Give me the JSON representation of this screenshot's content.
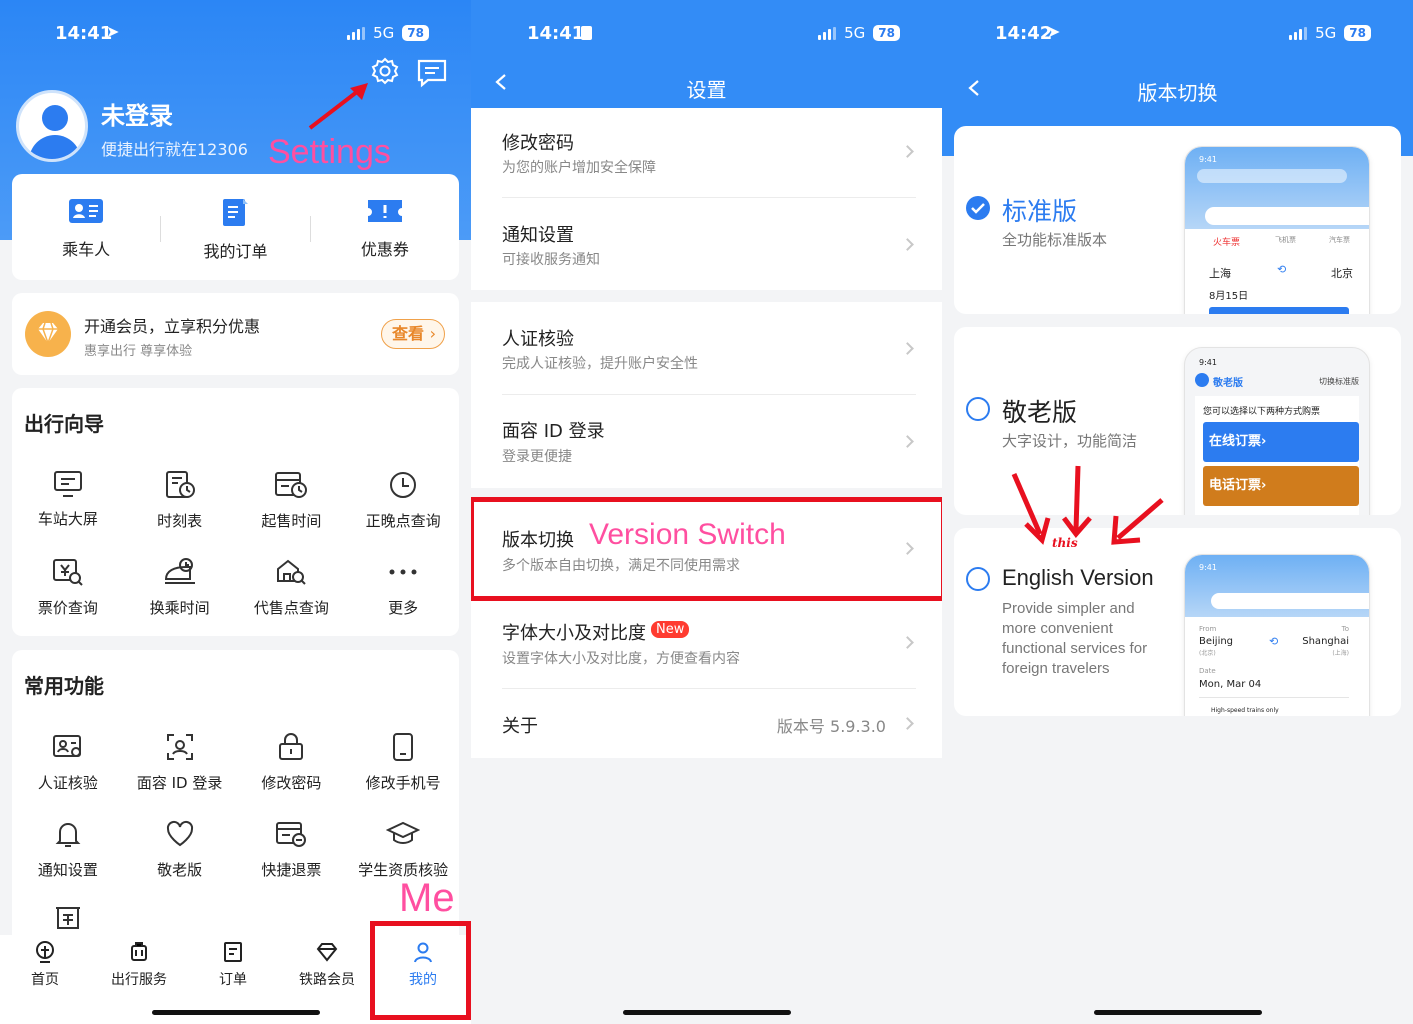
{
  "status": {
    "p1": {
      "time": "14:41",
      "network": "5G",
      "battery": "78"
    },
    "p2": {
      "time": "14:41",
      "network": "5G",
      "battery": "78"
    },
    "p3": {
      "time": "14:42",
      "network": "5G",
      "battery": "78"
    }
  },
  "me": {
    "user_name": "未登录",
    "user_tagline": "便捷出行就在12306",
    "quick": [
      {
        "label": "乘车人",
        "icon": "passenger-card-icon"
      },
      {
        "label": "我的订单",
        "icon": "order-doc-icon"
      },
      {
        "label": "优惠券",
        "icon": "coupon-icon"
      }
    ],
    "member": {
      "title": "开通会员，立享积分优惠",
      "subtitle": "惠享出行 尊享体验",
      "button": "查看"
    },
    "guide": {
      "title": "出行向导",
      "items": [
        {
          "label": "车站大屏",
          "icon": "screen-icon"
        },
        {
          "label": "时刻表",
          "icon": "timetable-icon"
        },
        {
          "label": "起售时间",
          "icon": "sale-time-icon"
        },
        {
          "label": "正晚点查询",
          "icon": "clock-icon"
        },
        {
          "label": "票价查询",
          "icon": "price-search-icon"
        },
        {
          "label": "换乘时间",
          "icon": "transfer-train-icon"
        },
        {
          "label": "代售点查询",
          "icon": "agency-search-icon"
        },
        {
          "label": "更多",
          "icon": "more-dots-icon"
        }
      ]
    },
    "common": {
      "title": "常用功能",
      "items": [
        {
          "label": "人证核验",
          "icon": "id-verify-icon"
        },
        {
          "label": "面容 ID 登录",
          "icon": "face-id-icon"
        },
        {
          "label": "修改密码",
          "icon": "lock-icon"
        },
        {
          "label": "修改手机号",
          "icon": "phone-icon"
        },
        {
          "label": "通知设置",
          "icon": "bell-icon"
        },
        {
          "label": "敬老版",
          "icon": "heart-icon"
        },
        {
          "label": "快捷退票",
          "icon": "refund-ticket-icon"
        },
        {
          "label": "学生资质核验",
          "icon": "graduation-cap-icon"
        }
      ]
    },
    "tabs": [
      {
        "label": "首页",
        "icon": "home-rail-icon"
      },
      {
        "label": "出行服务",
        "icon": "luggage-icon"
      },
      {
        "label": "订单",
        "icon": "order-icon"
      },
      {
        "label": "铁路会员",
        "icon": "diamond-icon"
      },
      {
        "label": "我的",
        "icon": "person-icon"
      }
    ],
    "ann_settings": "Settings",
    "ann_me": "Me"
  },
  "settings": {
    "title": "设置",
    "rows": [
      {
        "title": "修改密码",
        "subtitle": "为您的账户增加安全保障"
      },
      {
        "title": "通知设置",
        "subtitle": "可接收服务通知"
      },
      {
        "title": "人证核验",
        "subtitle": "完成人证核验，提升账户安全性"
      },
      {
        "title": "面容 ID 登录",
        "subtitle": "登录更便捷"
      },
      {
        "title": "版本切换",
        "subtitle": "多个版本自由切换，满足不同使用需求"
      },
      {
        "title": "字体大小及对比度",
        "subtitle": "设置字体大小及对比度，方便查看内容",
        "badge": "New"
      }
    ],
    "about": {
      "title": "关于",
      "value": "版本号 5.9.3.0"
    },
    "ann_version": "Version Switch"
  },
  "version": {
    "title": "版本切换",
    "options": [
      {
        "title": "标准版",
        "desc": "全功能标准版本",
        "selected": true
      },
      {
        "title": "敬老版",
        "desc": "大字设计，功能简洁",
        "selected": false
      },
      {
        "title": "English Version",
        "desc": "Provide simpler and more convenient functional services for foreign travelers",
        "selected": false
      }
    ],
    "ann_this": "this",
    "preview_std": {
      "time": "9:41",
      "tab1": "火车票",
      "tab2": "飞机票",
      "tab3": "汽车票",
      "from": "上海",
      "to": "北京",
      "date": "8月15日"
    },
    "preview_elder": {
      "time": "9:41",
      "brand": "敬老版",
      "switch": "切换标准版",
      "hint": "您可以选择以下两种方式购票",
      "btn1": "在线订票",
      "btn2": "电话订票"
    },
    "preview_en": {
      "time": "9:41",
      "from_lbl": "From",
      "from": "Beijing",
      "from_cn": "(北京)",
      "to_lbl": "To",
      "to": "Shanghai",
      "to_cn": "(上海)",
      "date_lbl": "Date",
      "date": "Mon, Mar 04",
      "note": "High-speed trains only"
    }
  },
  "colors": {
    "brand_blue": "#2c7cf0",
    "annotation_pink": "#ff4fa0",
    "highlight_red": "#e8101f",
    "elder_orange": "#d07c1c"
  }
}
